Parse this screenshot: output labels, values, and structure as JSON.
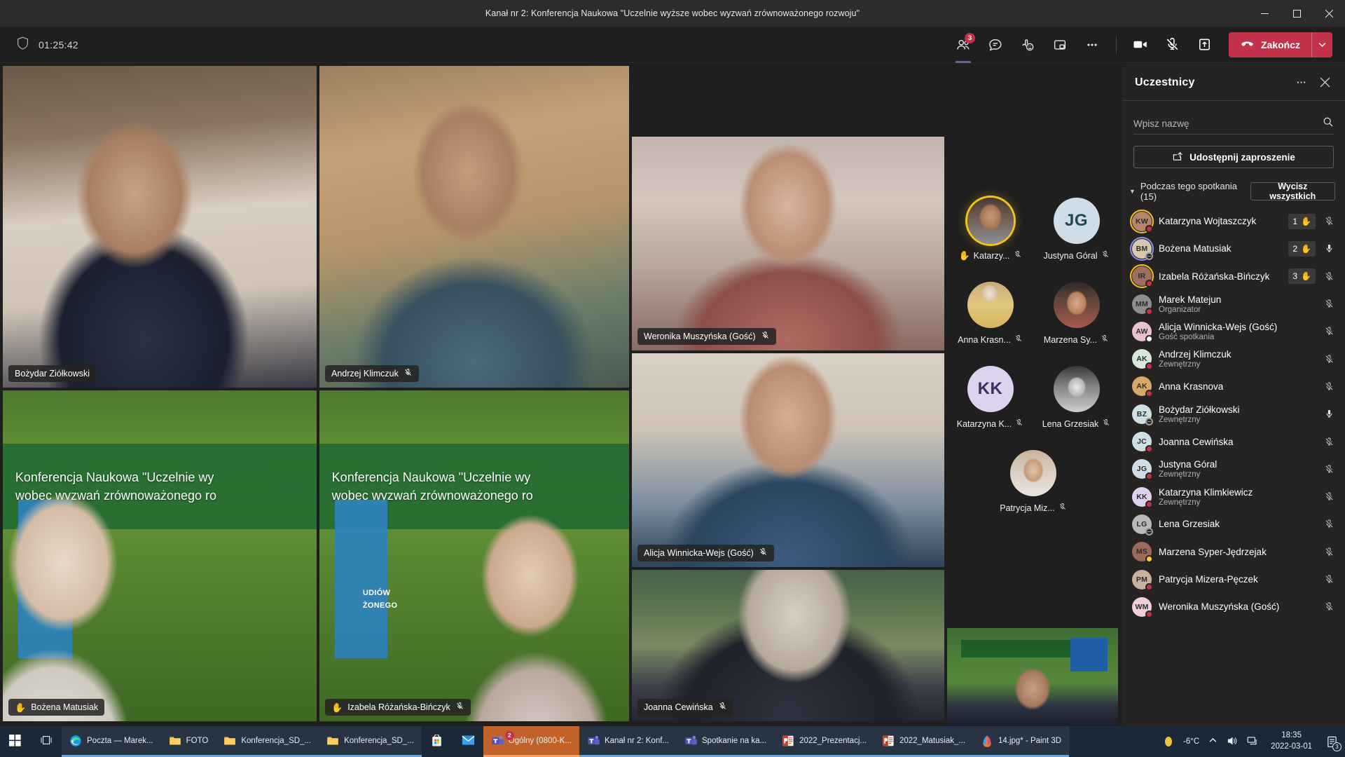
{
  "window": {
    "title": "Kanał nr 2: Konferencja Naukowa \"Uczelnie wyższe wobec wyzwań zrównoważonego rozwoju\"",
    "minimize": "–",
    "maximize": "□",
    "close": "✕"
  },
  "toolbar": {
    "shield_icon": "shield-icon",
    "timer": "01:25:42",
    "people_badge": "3",
    "buttons": [
      {
        "name": "people-button",
        "icon": "people-icon"
      },
      {
        "name": "chat-button",
        "icon": "chat-icon"
      },
      {
        "name": "reactions-button",
        "icon": "reactions-icon"
      },
      {
        "name": "breakout-rooms-button",
        "icon": "rooms-icon"
      },
      {
        "name": "more-options-button",
        "icon": "ellipsis-icon"
      },
      {
        "name": "camera-button",
        "icon": "camera-icon"
      },
      {
        "name": "microphone-button",
        "icon": "mic-off-icon"
      },
      {
        "name": "share-button",
        "icon": "share-up-icon"
      }
    ],
    "end_call_label": "Zakończ",
    "end_call_color": "#c4314b"
  },
  "stage": {
    "tiles": [
      {
        "name": "Bożydar Ziółkowski",
        "muted": false,
        "hand": false,
        "speaking": false,
        "style": "bg-boz"
      },
      {
        "name": "Andrzej Klimczuk",
        "muted": true,
        "hand": false,
        "speaking": false,
        "style": "bg-andrzej"
      },
      {
        "name": "Weronika Muszyńska (Gość)",
        "muted": true,
        "hand": false,
        "speaking": false,
        "style": "bg-weronika"
      },
      {
        "name": "Bożena Matusiak",
        "muted": false,
        "hand": true,
        "speaking": "violet",
        "style": "slide"
      },
      {
        "name": "Izabela Różańska-Bińczyk",
        "muted": true,
        "hand": true,
        "speaking": "gold",
        "style": "slide"
      },
      {
        "name": "Alicja Winnicka-Wejs (Gość)",
        "muted": true,
        "hand": false,
        "speaking": false,
        "style": "bg-alicja"
      },
      {
        "name": "Joanna Cewińska",
        "muted": true,
        "hand": false,
        "speaking": false,
        "style": "bg-joanna"
      }
    ],
    "slide": {
      "line1": "Konferencja Naukowa \"Uczelnie wy",
      "line2": "wobec wyzwań zrównoważonego ro",
      "badge1": "UDIÓW",
      "badge2": "ŻONEGO"
    }
  },
  "avatar_strip": [
    {
      "label": "Katarzy...",
      "initials": "",
      "muted": true,
      "hand": true,
      "ring": true,
      "color": "#d4a373"
    },
    {
      "label": "Justyna Góral",
      "initials": "JG",
      "muted": false,
      "hand": false,
      "ring": false,
      "color": "#cfdde6"
    },
    {
      "label": "Anna Krasn...",
      "initials": "",
      "muted": true,
      "hand": false,
      "ring": false,
      "color": "#d8b06a"
    },
    {
      "label": "Marzena Sy...",
      "initials": "",
      "muted": true,
      "hand": false,
      "ring": false,
      "color": "#9a6b5a"
    },
    {
      "label": "Katarzyna K...",
      "initials": "KK",
      "muted": true,
      "hand": false,
      "ring": false,
      "color": "#ded3ee"
    },
    {
      "label": "Lena Grzesiak",
      "initials": "",
      "muted": true,
      "hand": false,
      "ring": false,
      "color": "#b9b9b9"
    },
    {
      "label": "Patrycja Miz...",
      "initials": "",
      "muted": true,
      "hand": false,
      "ring": false,
      "color": "#c7b2a0"
    }
  ],
  "panel": {
    "title": "Uczestnicy",
    "more_icon": "ellipsis-icon",
    "close_icon": "close-icon",
    "search_placeholder": "Wpisz nazwę",
    "search_value": "",
    "search_icon": "search-icon",
    "invite_label": "Udostępnij zaproszenie",
    "invite_icon": "share-invite-icon",
    "section_label": "Podczas tego spotkania (15)",
    "mute_all_label": "Wycisz wszystkich",
    "participants": [
      {
        "name": "Katarzyna Wojtaszczyk",
        "role": "",
        "initials": "KW",
        "hand": "1",
        "muted": true,
        "ring": "gold",
        "presence": "busy",
        "color": "#b4856a"
      },
      {
        "name": "Bożena Matusiak",
        "role": "",
        "initials": "BM",
        "hand": "2",
        "muted": false,
        "ring": "violet",
        "presence": "dnd-ring",
        "color": "#d7c6b0"
      },
      {
        "name": "Izabela Różańska-Bińczyk",
        "role": "",
        "initials": "IR",
        "hand": "3",
        "muted": true,
        "ring": "gold",
        "presence": "busy",
        "color": "#9e6f5e"
      },
      {
        "name": "Marek Matejun",
        "role": "Organizator",
        "initials": "MM",
        "hand": "",
        "muted": true,
        "ring": "",
        "presence": "busy",
        "color": "#8d8d8d"
      },
      {
        "name": "Alicja Winnicka-Wejs (Gość)",
        "role": "Gość spotkania",
        "initials": "AW",
        "hand": "",
        "muted": true,
        "ring": "",
        "presence": "avail",
        "color": "#e8c3cf"
      },
      {
        "name": "Andrzej Klimczuk",
        "role": "Zewnętrzny",
        "initials": "AK",
        "hand": "",
        "muted": true,
        "ring": "",
        "presence": "busy",
        "color": "#d6e7dc"
      },
      {
        "name": "Anna Krasnova",
        "role": "",
        "initials": "AK",
        "hand": "",
        "muted": true,
        "ring": "",
        "presence": "busy",
        "color": "#d8a86a"
      },
      {
        "name": "Bożydar Ziółkowski",
        "role": "Zewnętrzny",
        "initials": "BZ",
        "hand": "",
        "muted": false,
        "ring": "",
        "presence": "dnd-ring",
        "color": "#cfe0e4"
      },
      {
        "name": "Joanna Cewińska",
        "role": "",
        "initials": "JC",
        "hand": "",
        "muted": true,
        "ring": "",
        "presence": "busy",
        "color": "#cfe0e4"
      },
      {
        "name": "Justyna Góral",
        "role": "Zewnętrzny",
        "initials": "JG",
        "hand": "",
        "muted": true,
        "ring": "",
        "presence": "busy",
        "color": "#cfdde6"
      },
      {
        "name": "Katarzyna Klimkiewicz",
        "role": "Zewnętrzny",
        "initials": "KK",
        "hand": "",
        "muted": true,
        "ring": "",
        "presence": "busy",
        "color": "#ded3ee"
      },
      {
        "name": "Lena Grzesiak",
        "role": "",
        "initials": "LG",
        "hand": "",
        "muted": true,
        "ring": "",
        "presence": "dnd-ring",
        "color": "#b9b9b9"
      },
      {
        "name": "Marzena Syper-Jędrzejak",
        "role": "",
        "initials": "MS",
        "hand": "",
        "muted": true,
        "ring": "",
        "presence": "away",
        "color": "#9a6b5a"
      },
      {
        "name": "Patrycja Mizera-Pęczek",
        "role": "",
        "initials": "PM",
        "hand": "",
        "muted": true,
        "ring": "",
        "presence": "busy",
        "color": "#c7b2a0"
      },
      {
        "name": "Weronika Muszyńska (Gość)",
        "role": "",
        "initials": "WM",
        "hand": "",
        "muted": true,
        "ring": "",
        "presence": "busy",
        "color": "#f0d0da"
      }
    ]
  },
  "taskbar": {
    "start_icon": "windows-start-icon",
    "taskview_icon": "task-view-icon",
    "items": [
      {
        "label": "Poczta — Marek...",
        "icon": "edge-icon",
        "state": "open"
      },
      {
        "label": "FOTO",
        "icon": "folder-icon",
        "state": "open"
      },
      {
        "label": "Konferencja_SD_...",
        "icon": "folder-icon",
        "state": "open"
      },
      {
        "label": "Konferencja_SD_...",
        "icon": "folder-icon",
        "state": "open"
      },
      {
        "label": "",
        "icon": "store-icon",
        "state": "pinned"
      },
      {
        "label": "",
        "icon": "mail-icon",
        "state": "pinned"
      },
      {
        "label": "Ogólny (0800-K...",
        "icon": "teams-icon",
        "state": "active",
        "badge": "2"
      },
      {
        "label": "Kanał nr 2: Konf...",
        "icon": "teams-icon",
        "state": "open"
      },
      {
        "label": "Spotkanie na ka...",
        "icon": "teams-icon",
        "state": "open"
      },
      {
        "label": "2022_Prezentacj...",
        "icon": "powerpoint-icon",
        "state": "open"
      },
      {
        "label": "2022_Matusiak_...",
        "icon": "powerpoint-icon",
        "state": "open"
      },
      {
        "label": "14.jpg* - Paint 3D",
        "icon": "paint3d-icon",
        "state": "open"
      }
    ],
    "tray": {
      "weather_icon": "weather-sun-icon",
      "temperature": "-6°C",
      "chevron_icon": "chevron-up-icon",
      "volume_icon": "volume-icon",
      "network_icon": "network-icon",
      "time": "18:35",
      "date": "2022-03-01",
      "notifications_icon": "notifications-icon",
      "notifications_count": "3"
    }
  }
}
